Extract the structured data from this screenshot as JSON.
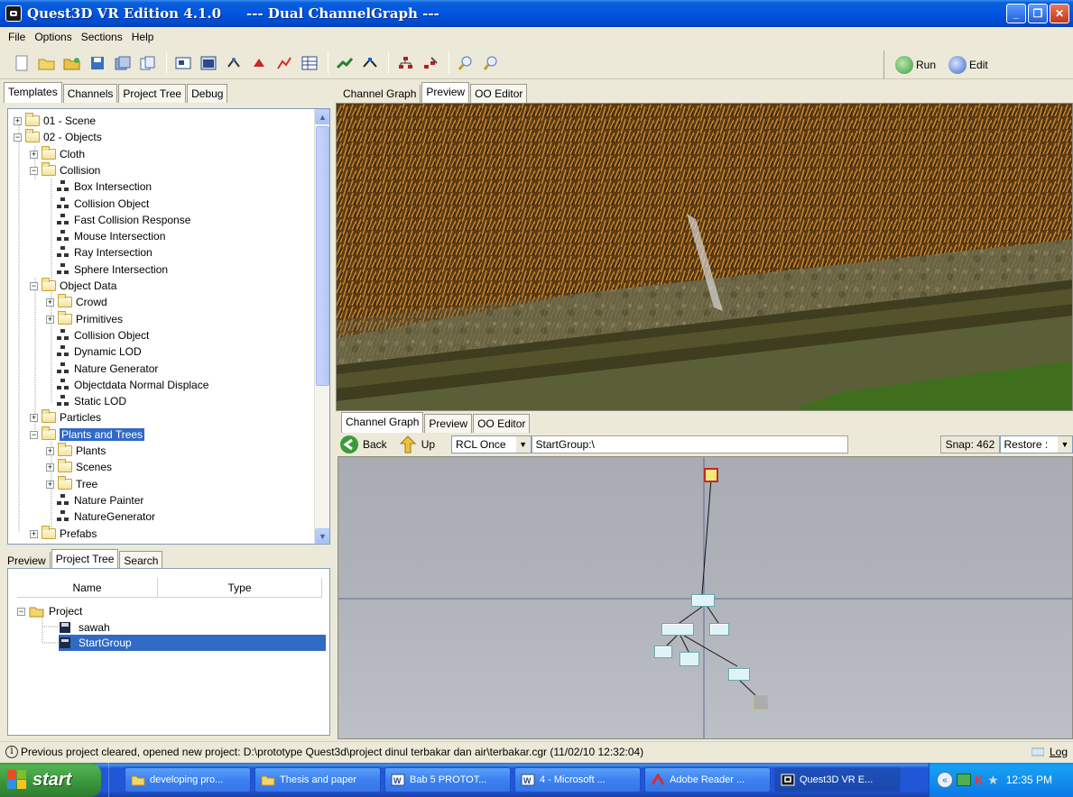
{
  "window": {
    "app_title": "Quest3D VR Edition 4.1.0",
    "doc_title": "--- Dual ChannelGraph ---",
    "controls": [
      "_",
      "❐",
      "✕"
    ]
  },
  "menu": [
    "File",
    "Options",
    "Sections",
    "Help"
  ],
  "toolbar": {
    "run_label": "Run",
    "edit_label": "Edit"
  },
  "left_tabs": [
    "Templates",
    "Channels",
    "Project Tree",
    "Debug"
  ],
  "templates_tree": [
    {
      "label": "01 - Scene",
      "level": 0,
      "kind": "folder",
      "toggle": "+"
    },
    {
      "label": "02 - Objects",
      "level": 0,
      "kind": "folder",
      "toggle": "-"
    },
    {
      "label": "Cloth",
      "level": 1,
      "kind": "folder",
      "toggle": "+"
    },
    {
      "label": "Collision",
      "level": 1,
      "kind": "folder",
      "toggle": "-"
    },
    {
      "label": "Box Intersection",
      "level": 2,
      "kind": "node"
    },
    {
      "label": "Collision Object",
      "level": 2,
      "kind": "node"
    },
    {
      "label": "Fast Collision Response",
      "level": 2,
      "kind": "node"
    },
    {
      "label": "Mouse Intersection",
      "level": 2,
      "kind": "node"
    },
    {
      "label": "Ray Intersection",
      "level": 2,
      "kind": "node"
    },
    {
      "label": "Sphere Intersection",
      "level": 2,
      "kind": "node"
    },
    {
      "label": "Object Data",
      "level": 1,
      "kind": "folder",
      "toggle": "-"
    },
    {
      "label": "Crowd",
      "level": 2,
      "kind": "folder",
      "toggle": "+"
    },
    {
      "label": "Primitives",
      "level": 2,
      "kind": "folder",
      "toggle": "+"
    },
    {
      "label": "Collision Object",
      "level": 2,
      "kind": "node"
    },
    {
      "label": "Dynamic LOD",
      "level": 2,
      "kind": "node"
    },
    {
      "label": "Nature Generator",
      "level": 2,
      "kind": "node"
    },
    {
      "label": "Objectdata Normal Displace",
      "level": 2,
      "kind": "node"
    },
    {
      "label": "Static LOD",
      "level": 2,
      "kind": "node"
    },
    {
      "label": "Particles",
      "level": 1,
      "kind": "folder",
      "toggle": "+"
    },
    {
      "label": "Plants and Trees",
      "level": 1,
      "kind": "folder",
      "toggle": "-",
      "selected": true
    },
    {
      "label": "Plants",
      "level": 2,
      "kind": "folder",
      "toggle": "+"
    },
    {
      "label": "Scenes",
      "level": 2,
      "kind": "folder",
      "toggle": "+"
    },
    {
      "label": "Tree",
      "level": 2,
      "kind": "folder",
      "toggle": "+"
    },
    {
      "label": "Nature Painter",
      "level": 2,
      "kind": "node"
    },
    {
      "label": "NatureGenerator",
      "level": 2,
      "kind": "node"
    },
    {
      "label": "Prefabs",
      "level": 1,
      "kind": "folder",
      "toggle": "+"
    }
  ],
  "bottom_left_tabs": [
    "Preview",
    "Project Tree",
    "Search"
  ],
  "project_tree": {
    "columns": [
      "Name",
      "Type"
    ],
    "root": "Project",
    "items": [
      "sawah",
      "StartGroup"
    ]
  },
  "top_right_tabs": [
    "Channel Graph",
    "Preview",
    "OO Editor"
  ],
  "bottom_right_tabs": [
    "Channel Graph",
    "Preview",
    "OO Editor"
  ],
  "graph_toolbar": {
    "back_label": "Back",
    "up_label": "Up",
    "mode_value": "RCL Once",
    "path_value": "StartGroup:\\",
    "snap_label": "Snap: 462",
    "restore_value": "Restore :"
  },
  "status": {
    "message": "Previous project cleared, opened new project: D:\\prototype Quest3d\\project dinul terbakar dan air\\terbakar.cgr (11/02/10 12:32:04)",
    "log_label": "Log"
  },
  "taskbar": {
    "start_label": "start",
    "tasks": [
      {
        "label": "developing pro...",
        "icon": "folder-icon"
      },
      {
        "label": "Thesis and paper",
        "icon": "folder-icon"
      },
      {
        "label": "Bab 5 PROTOT...",
        "icon": "word-doc-icon"
      },
      {
        "label": "4 - Microsoft ...",
        "icon": "word-doc-icon"
      },
      {
        "label": "Adobe Reader ...",
        "icon": "adobe-reader-icon"
      },
      {
        "label": "Quest3D VR E...",
        "icon": "quest3d-icon",
        "active": true
      }
    ],
    "clock": "12:35 PM"
  },
  "colors": {
    "selection": "#316ac5",
    "titlebar": "#0054e3",
    "graph_bg": "#aeb1b8",
    "node_fill": "#dff3f8"
  }
}
